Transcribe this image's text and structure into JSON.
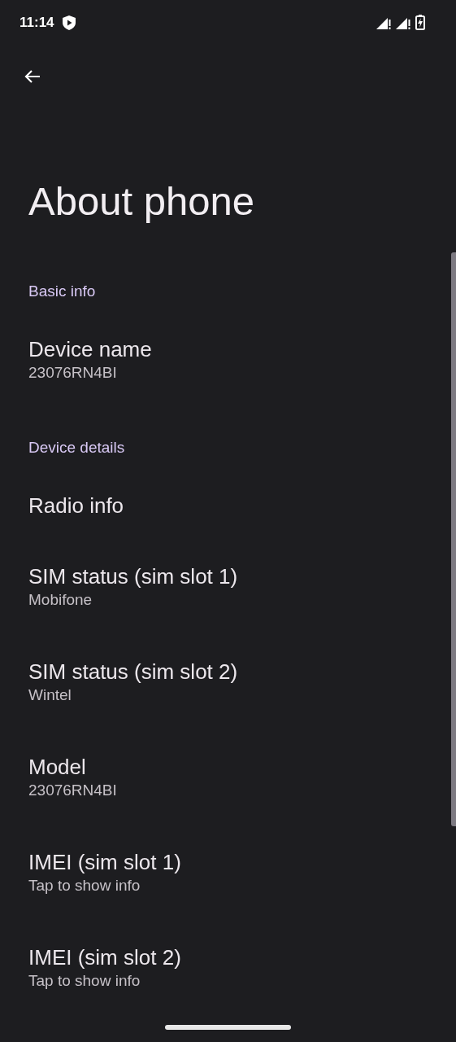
{
  "status_bar": {
    "time": "11:14"
  },
  "title": "About phone",
  "sections": [
    {
      "header": "Basic info",
      "items": [
        {
          "title": "Device name",
          "summary": "23076RN4BI"
        }
      ]
    },
    {
      "header": "Device details",
      "items": [
        {
          "title": "Radio info"
        },
        {
          "title": "SIM status (sim slot 1)",
          "summary": "Mobifone"
        },
        {
          "title": "SIM status (sim slot 2)",
          "summary": "Wintel"
        },
        {
          "title": "Model",
          "summary": "23076RN4BI"
        },
        {
          "title": "IMEI (sim slot 1)",
          "summary": "Tap to show info"
        },
        {
          "title": "IMEI (sim slot 2)",
          "summary": "Tap to show info"
        }
      ]
    }
  ]
}
